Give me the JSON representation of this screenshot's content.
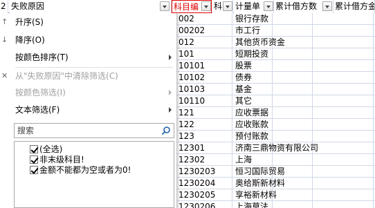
{
  "header": {
    "row_number": "2",
    "col_a_title": "失败原因",
    "col_b_title": "科目编",
    "col_c_title": "科",
    "col_d_title": "计量单",
    "col_e_title": "累计借方数",
    "col_f_title": "累计借方金"
  },
  "menu": {
    "sort_asc": "升序(S)",
    "sort_desc": "降序(O)",
    "sort_by_color": "按颜色排序(T)",
    "clear_filter": "从\"失败原因\"中清除筛选(C)",
    "filter_by_color": "按颜色筛选(I)",
    "text_filter": "文本筛选(F)",
    "search_placeholder": "搜索",
    "options": [
      "(全选)",
      "非末级科目!",
      "金额不能都为空或者为0!"
    ]
  },
  "grid": {
    "rows": [
      {
        "code": "002",
        "name": "银行存款"
      },
      {
        "code": "00202",
        "name": "市工行"
      },
      {
        "code": "012",
        "name": "其他货币资金"
      },
      {
        "code": "101",
        "name": "短期投资"
      },
      {
        "code": "10101",
        "name": "股票"
      },
      {
        "code": "10102",
        "name": "债券"
      },
      {
        "code": "10103",
        "name": "基金"
      },
      {
        "code": "10110",
        "name": "其它"
      },
      {
        "code": "121",
        "name": "应收票据"
      },
      {
        "code": "122",
        "name": "应收账款"
      },
      {
        "code": "123",
        "name": "预付账款"
      },
      {
        "code": "12301",
        "name": "济南三鼎物资有限公司"
      },
      {
        "code": "12302",
        "name": "上海"
      },
      {
        "code": "1230203",
        "name": "恒习国际贸易"
      },
      {
        "code": "1230204",
        "name": "奥给斯新材料"
      },
      {
        "code": "1230205",
        "name": "享裕新材料"
      },
      {
        "code": "1230206",
        "name": "上海草法"
      }
    ]
  },
  "colors": {
    "header_red": "#e00000",
    "grid_line": "#d0d7e5",
    "disabled_text": "#a0a0a0"
  }
}
